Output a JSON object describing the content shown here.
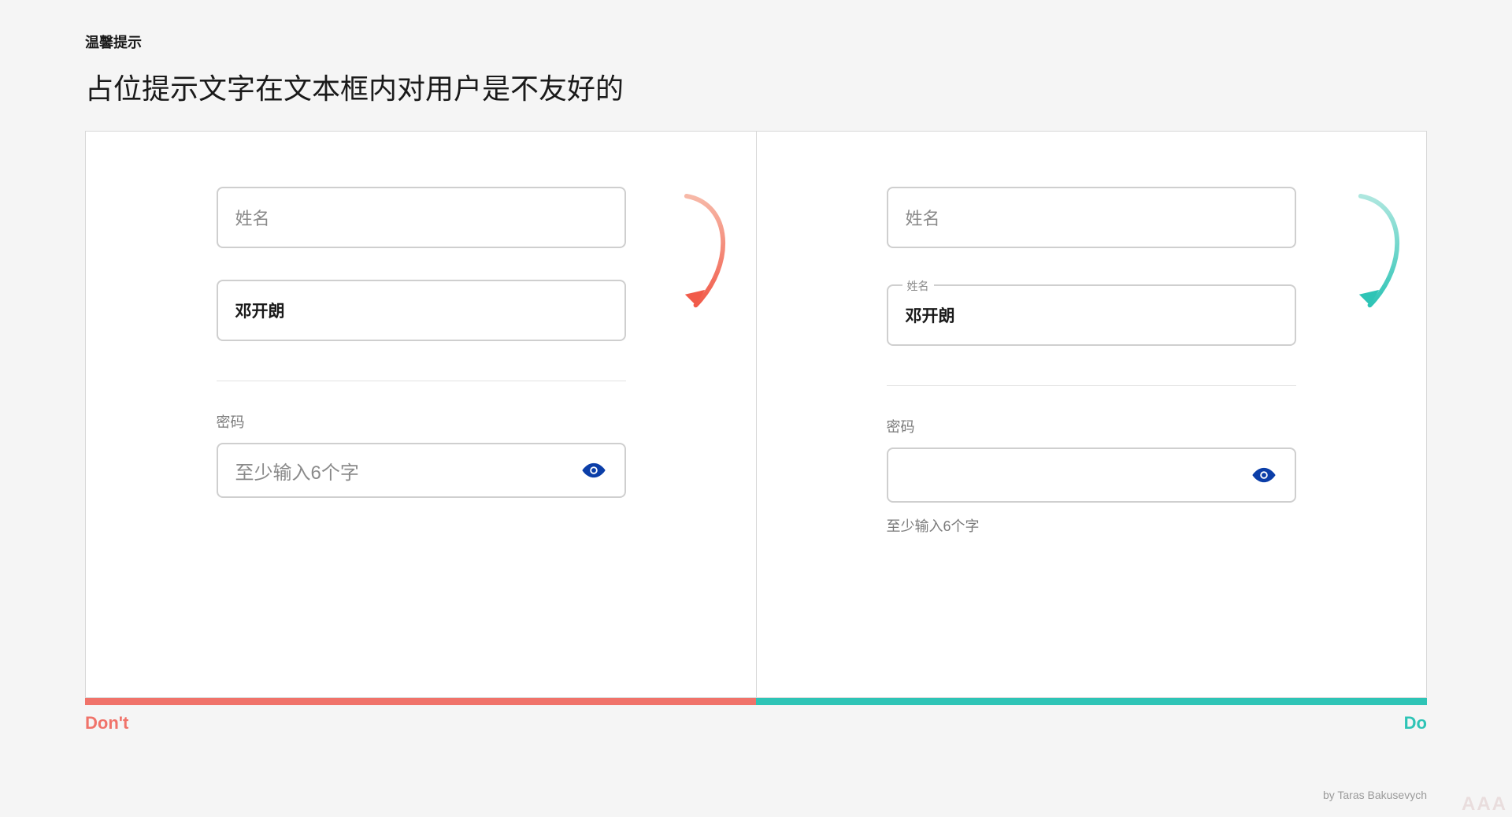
{
  "header": {
    "eyebrow": "温馨提示",
    "headline": "占位提示文字在文本框内对用户是不友好的"
  },
  "dont": {
    "name_placeholder": "姓名",
    "name_value": "邓开朗",
    "password_label": "密码",
    "password_placeholder": "至少输入6个字",
    "caption": "Don't"
  },
  "do": {
    "name_placeholder": "姓名",
    "name_float_label": "姓名",
    "name_value": "邓开朗",
    "password_label": "密码",
    "password_helper": "至少输入6个字",
    "caption": "Do"
  },
  "credit": "by Taras Bakusevych",
  "watermark": "AAA",
  "colors": {
    "dont": "#f0736a",
    "do": "#2ec4b6",
    "eye": "#0b3ea8"
  }
}
